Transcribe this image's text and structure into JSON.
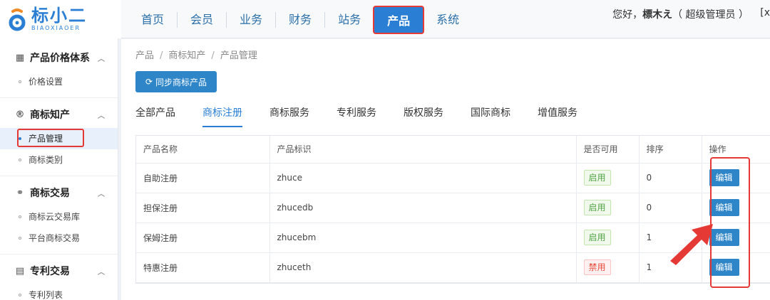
{
  "logo": {
    "title": "标小二",
    "subtitle": "BIAOXIAOER"
  },
  "topnav": {
    "items": [
      {
        "label": "首页"
      },
      {
        "label": "会员"
      },
      {
        "label": "业务"
      },
      {
        "label": "财务"
      },
      {
        "label": "站务"
      },
      {
        "label": "产品"
      },
      {
        "label": "系统"
      }
    ],
    "active_index": 5,
    "greeting_prefix": "您好，",
    "username": "標木え",
    "role": "（ 超级管理员 ）",
    "edge_char": "[x"
  },
  "sidebar": {
    "sections": [
      {
        "title": "产品价格体系",
        "icon": "calculator-icon",
        "items": [
          {
            "label": "价格设置"
          }
        ]
      },
      {
        "title": "商标知产",
        "icon": "registered-icon",
        "items": [
          {
            "label": "产品管理",
            "active": true
          },
          {
            "label": "商标类别"
          }
        ]
      },
      {
        "title": "商标交易",
        "icon": "handshake-icon",
        "items": [
          {
            "label": "商标云交易库"
          },
          {
            "label": "平台商标交易"
          }
        ]
      },
      {
        "title": "专利交易",
        "icon": "document-icon",
        "items": [
          {
            "label": "专利列表"
          }
        ]
      }
    ]
  },
  "breadcrumb": [
    "产品",
    "商标知产",
    "产品管理"
  ],
  "sync_button": {
    "label": "同步商标产品"
  },
  "tabs": [
    {
      "label": "全部产品"
    },
    {
      "label": "商标注册",
      "active": true
    },
    {
      "label": "商标服务"
    },
    {
      "label": "专利服务"
    },
    {
      "label": "版权服务"
    },
    {
      "label": "国际商标"
    },
    {
      "label": "增值服务"
    }
  ],
  "table": {
    "columns": [
      "产品名称",
      "产品标识",
      "是否可用",
      "排序",
      "操作"
    ],
    "rows": [
      {
        "name": "自助注册",
        "code": "zhuce",
        "status": "启用",
        "enabled": true,
        "sort": "0",
        "action": "编辑"
      },
      {
        "name": "担保注册",
        "code": "zhucedb",
        "status": "启用",
        "enabled": true,
        "sort": "0",
        "action": "编辑"
      },
      {
        "name": "保姆注册",
        "code": "zhucebm",
        "status": "启用",
        "enabled": true,
        "sort": "1",
        "action": "编辑"
      },
      {
        "name": "特惠注册",
        "code": "zhuceth",
        "status": "禁用",
        "enabled": false,
        "sort": "1",
        "action": "编辑"
      }
    ]
  },
  "colors": {
    "primary": "#2a7fd4",
    "button": "#2e86c8",
    "highlight": "#e53935",
    "enabled": "#52a447",
    "disabled": "#e74c3c"
  }
}
